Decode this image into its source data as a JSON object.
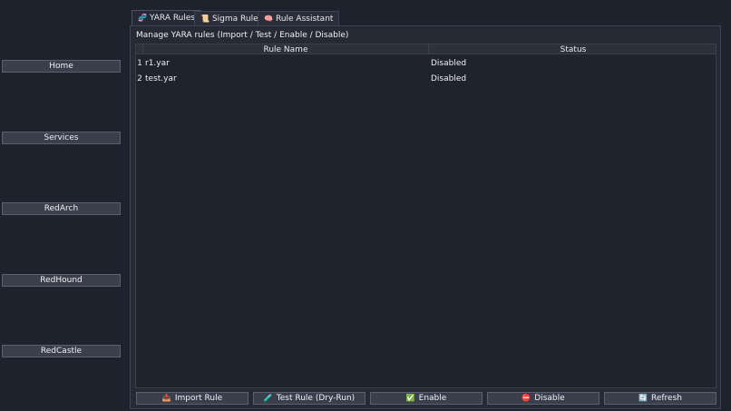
{
  "sidebar": {
    "items": [
      {
        "label": "Home"
      },
      {
        "label": "Services"
      },
      {
        "label": "RedArch"
      },
      {
        "label": "RedHound"
      },
      {
        "label": "RedCastle"
      }
    ]
  },
  "tabs": [
    {
      "label": "YARA Rules",
      "icon": "🧬",
      "active": true
    },
    {
      "label": "Sigma Rules",
      "icon": "📜",
      "active": false
    },
    {
      "label": "Rule Assistant",
      "icon": "🧠",
      "active": false
    }
  ],
  "panel": {
    "title": "Manage YARA rules (Import / Test / Enable / Disable)"
  },
  "table": {
    "columns": [
      "Rule Name",
      "Status"
    ],
    "rows": [
      {
        "num": "1",
        "name": "r1.yar",
        "status": "Disabled"
      },
      {
        "num": "2",
        "name": "test.yar",
        "status": "Disabled"
      }
    ]
  },
  "actions": [
    {
      "label": "Import Rule",
      "icon": "📥"
    },
    {
      "label": "Test Rule (Dry-Run)",
      "icon": "🧪"
    },
    {
      "label": "Enable",
      "icon": "✅"
    },
    {
      "label": "Disable",
      "icon": "⛔"
    },
    {
      "label": "Refresh",
      "icon": "🔄"
    }
  ]
}
